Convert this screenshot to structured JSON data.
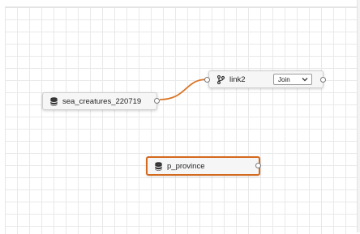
{
  "canvas": {
    "grid": "on"
  },
  "nodes": {
    "source": {
      "label": "sea_creatures_220719",
      "icon": "database-icon"
    },
    "join": {
      "label": "link2",
      "icon": "branch-merge-icon",
      "join_type": {
        "selected": "Join"
      }
    },
    "province": {
      "label": "p_province",
      "icon": "database-icon",
      "selected": true
    }
  },
  "colors": {
    "connection": "#d9772a",
    "selection": "#d46a1f",
    "grid_line": "#e9e9e9"
  }
}
